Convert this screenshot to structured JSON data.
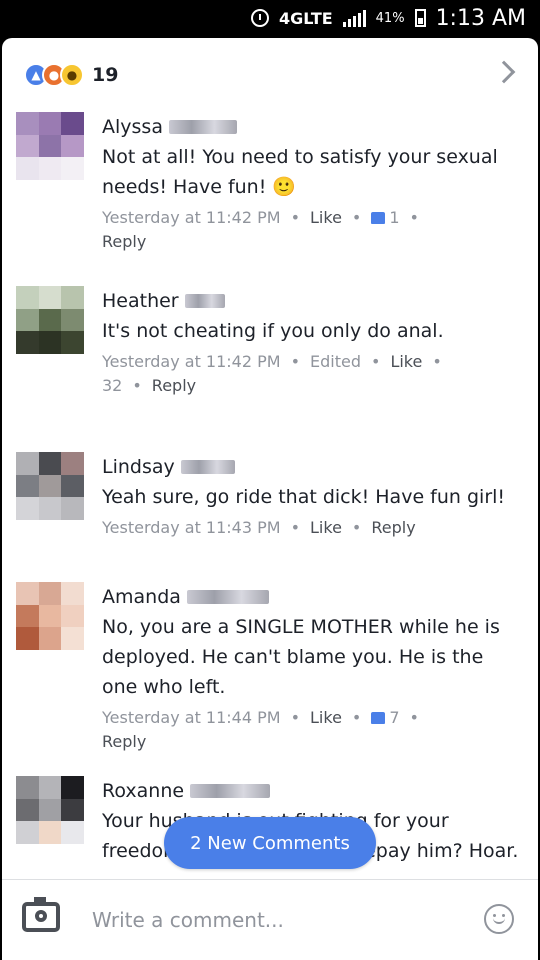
{
  "status_bar": {
    "network": "4GLTE",
    "battery": "41%",
    "time": "1:13 AM"
  },
  "reactions": {
    "count": "19",
    "icons": [
      "like-icon",
      "angry-icon",
      "haha-icon"
    ]
  },
  "comments": [
    {
      "name": "Alyssa",
      "text": "Not at all! You need to satisfy your sexual needs! Have fun! 🙂",
      "time": "Yesterday at 11:42 PM",
      "edited": "",
      "like": "Like",
      "like_count": "1",
      "reply": "Reply"
    },
    {
      "name": "Heather",
      "text": "It's not cheating if you only do anal.",
      "time": "Yesterday at 11:42 PM",
      "edited": "Edited",
      "like": "Like",
      "like_count": "32",
      "reply": "Reply"
    },
    {
      "name": "Lindsay",
      "text": "Yeah sure, go ride that dick! Have fun girl!",
      "time": "Yesterday at 11:43 PM",
      "edited": "",
      "like": "Like",
      "like_count": "",
      "reply": "Reply"
    },
    {
      "name": "Amanda",
      "text": "No, you are a SINGLE MOTHER while he is deployed. He can't blame you. He is the one who left.",
      "time": "Yesterday at 11:44 PM",
      "edited": "",
      "like": "Like",
      "like_count": "7",
      "reply": "Reply"
    },
    {
      "name": "Roxanne",
      "text": "Your husband is out fighting for your freedom & this is how you repay him? Hoar.",
      "time": "",
      "edited": "",
      "like": "",
      "like_count": "",
      "reply": ""
    }
  ],
  "new_comments_button": "2 New Comments",
  "composer": {
    "placeholder": "Write a comment..."
  },
  "colors": {
    "facebook_blue": "#4a7fe8",
    "meta_gray": "#90949c",
    "text": "#1d2129"
  }
}
